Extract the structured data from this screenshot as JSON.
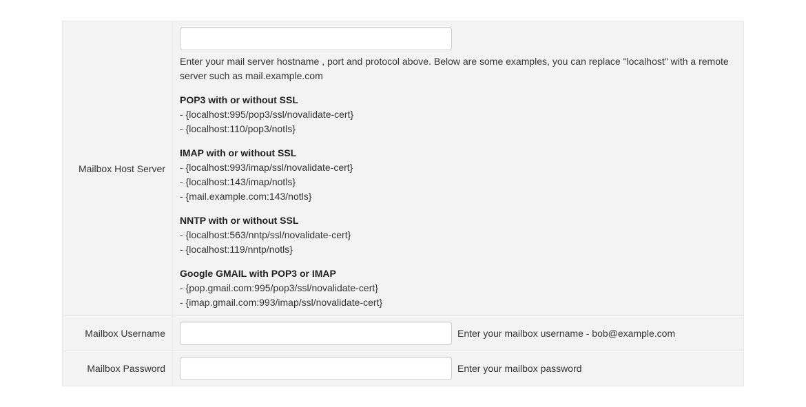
{
  "rows": {
    "host": {
      "label": "Mailbox Host Server",
      "value": "",
      "help": "Enter your mail server hostname , port and protocol above. Below are some examples, you can replace \"localhost\" with a remote server such as mail.example.com",
      "examples": [
        {
          "title": "POP3 with or without SSL",
          "lines": [
            "- {localhost:995/pop3/ssl/novalidate-cert}",
            "- {localhost:110/pop3/notls}"
          ]
        },
        {
          "title": "IMAP with or without SSL",
          "lines": [
            "- {localhost:993/imap/ssl/novalidate-cert}",
            "- {localhost:143/imap/notls}",
            "- {mail.example.com:143/notls}"
          ]
        },
        {
          "title": "NNTP with or without SSL",
          "lines": [
            "- {localhost:563/nntp/ssl/novalidate-cert}",
            "- {localhost:119/nntp/notls}"
          ]
        },
        {
          "title": "Google GMAIL with POP3 or IMAP",
          "lines": [
            "- {pop.gmail.com:995/pop3/ssl/novalidate-cert}",
            "- {imap.gmail.com:993/imap/ssl/novalidate-cert}"
          ]
        }
      ]
    },
    "username": {
      "label": "Mailbox Username",
      "value": "",
      "help": "Enter your mailbox username - bob@example.com"
    },
    "password": {
      "label": "Mailbox Password",
      "value": "",
      "help": "Enter your mailbox password"
    }
  }
}
